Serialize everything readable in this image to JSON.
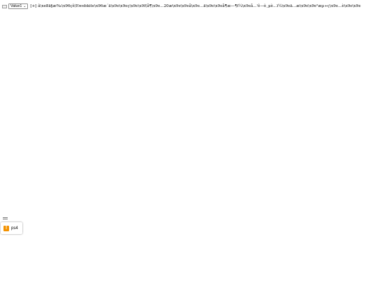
{
  "toolbar": {
    "selected_value": "Value1",
    "status_text": "[+] ã\\xe8ä§æ‰\\x96çš(Ewebkite\\x96æ´ä\\x9e\\x9eç\\x9e\\x9f(å¶\\x9e...20æ\\x9e\\x9eå\\x9e...ä\\x9e\\x9eå¶æ—¶ï¼\\x9eå...'ê—è¸µè...ï¼\\x9eä...æ\\x9e\\x9e²æµ÷ç\\x9e...è\\x9e\\x9e"
  },
  "notification": {
    "icon": "!",
    "label": "ps4",
    "accent": "#f39200"
  }
}
